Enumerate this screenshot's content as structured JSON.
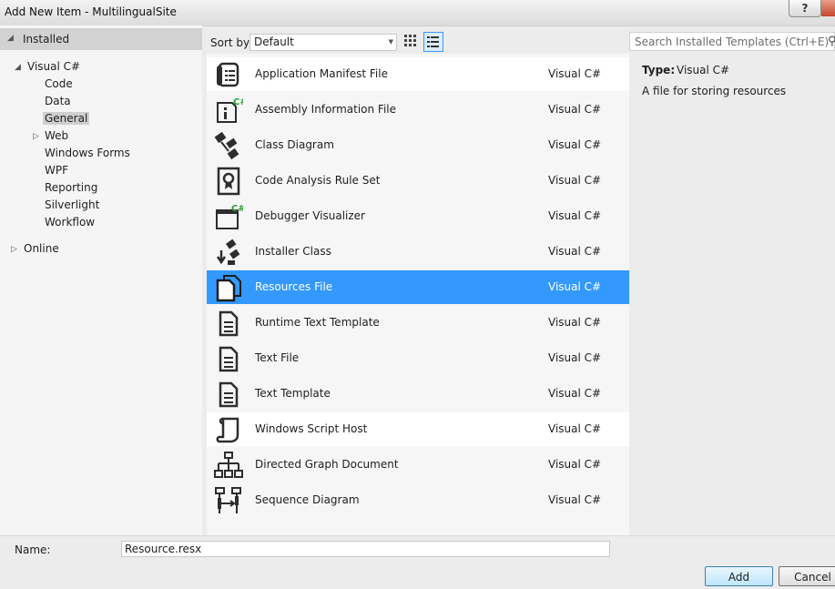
{
  "window": {
    "title": "Add New Item - MultilingualSite",
    "help_label": "?"
  },
  "nav": {
    "installed": "Installed",
    "visual_csharp": "Visual C#",
    "children": [
      "Code",
      "Data",
      "General",
      "Web",
      "Windows Forms",
      "WPF",
      "Reporting",
      "Silverlight",
      "Workflow"
    ],
    "online": "Online"
  },
  "toolbar": {
    "sort_label": "Sort by:",
    "sort_value": "Default"
  },
  "items": [
    {
      "name": "Application Manifest File",
      "lang": "Visual C#",
      "icon": "manifest-icon"
    },
    {
      "name": "Assembly Information File",
      "lang": "Visual C#",
      "icon": "assembly-info-icon"
    },
    {
      "name": "Class Diagram",
      "lang": "Visual C#",
      "icon": "class-diagram-icon"
    },
    {
      "name": "Code Analysis Rule Set",
      "lang": "Visual C#",
      "icon": "rule-set-icon"
    },
    {
      "name": "Debugger Visualizer",
      "lang": "Visual C#",
      "icon": "debugger-visualizer-icon"
    },
    {
      "name": "Installer Class",
      "lang": "Visual C#",
      "icon": "installer-icon"
    },
    {
      "name": "Resources File",
      "lang": "Visual C#",
      "icon": "resources-file-icon"
    },
    {
      "name": "Runtime Text Template",
      "lang": "Visual C#",
      "icon": "text-template-icon"
    },
    {
      "name": "Text File",
      "lang": "Visual C#",
      "icon": "text-file-icon"
    },
    {
      "name": "Text Template",
      "lang": "Visual C#",
      "icon": "text-template-icon"
    },
    {
      "name": "Windows Script Host",
      "lang": "Visual C#",
      "icon": "script-host-icon"
    },
    {
      "name": "Directed Graph Document",
      "lang": "Visual C#",
      "icon": "directed-graph-icon"
    },
    {
      "name": "Sequence Diagram",
      "lang": "Visual C#",
      "icon": "sequence-diagram-icon"
    }
  ],
  "details": {
    "search_placeholder": "Search Installed Templates (Ctrl+E)",
    "type_label": "Type:",
    "type_value": "Visual C#",
    "description": "A file for storing resources"
  },
  "bottom": {
    "name_label": "Name:",
    "name_value": "Resource.resx",
    "add_label": "Add",
    "cancel_label": "Cancel"
  },
  "colors": {
    "selection": "#3399ff",
    "csharp_badge": "#2e9d3a"
  }
}
